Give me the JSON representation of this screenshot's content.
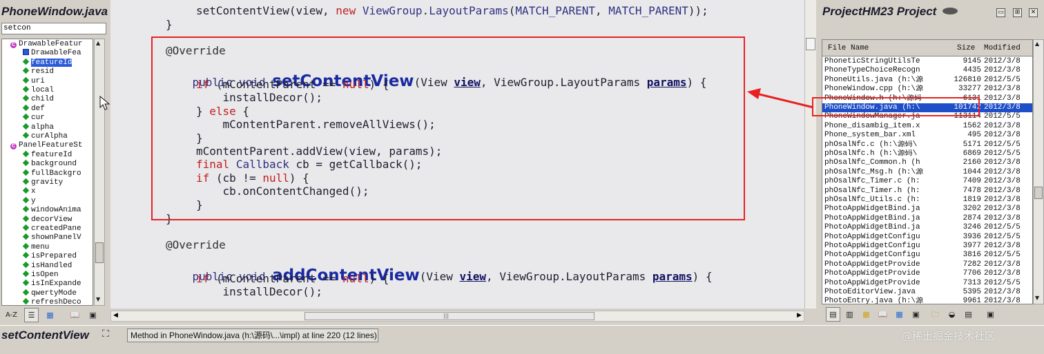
{
  "left_panel": {
    "title": "PhoneWindow.java",
    "search_value": "setcon",
    "tree": [
      {
        "label": "DrawableFeatur",
        "kind": "class",
        "depth": 0
      },
      {
        "label": "DrawableFea",
        "kind": "selected-class",
        "depth": 1
      },
      {
        "label": "featureId",
        "kind": "field",
        "depth": 1,
        "selected": true
      },
      {
        "label": "resid",
        "kind": "field",
        "depth": 1
      },
      {
        "label": "uri",
        "kind": "field",
        "depth": 1
      },
      {
        "label": "local",
        "kind": "field",
        "depth": 1
      },
      {
        "label": "child",
        "kind": "field",
        "depth": 1
      },
      {
        "label": "def",
        "kind": "field",
        "depth": 1
      },
      {
        "label": "cur",
        "kind": "field",
        "depth": 1
      },
      {
        "label": "alpha",
        "kind": "field",
        "depth": 1
      },
      {
        "label": "curAlpha",
        "kind": "field",
        "depth": 1
      },
      {
        "label": "PanelFeatureSt",
        "kind": "class",
        "depth": 0
      },
      {
        "label": "featureId",
        "kind": "field",
        "depth": 1
      },
      {
        "label": "background",
        "kind": "field",
        "depth": 1
      },
      {
        "label": "fullBackgro",
        "kind": "field",
        "depth": 1
      },
      {
        "label": "gravity",
        "kind": "field",
        "depth": 1
      },
      {
        "label": "x",
        "kind": "field",
        "depth": 1
      },
      {
        "label": "y",
        "kind": "field",
        "depth": 1
      },
      {
        "label": "windowAnima",
        "kind": "field",
        "depth": 1
      },
      {
        "label": "decorView",
        "kind": "field",
        "depth": 1
      },
      {
        "label": "createdPane",
        "kind": "field",
        "depth": 1
      },
      {
        "label": "shownPanelV",
        "kind": "field",
        "depth": 1
      },
      {
        "label": "menu",
        "kind": "field",
        "depth": 1
      },
      {
        "label": "isPrepared",
        "kind": "field",
        "depth": 1
      },
      {
        "label": "isHandled",
        "kind": "field",
        "depth": 1
      },
      {
        "label": "isOpen",
        "kind": "field",
        "depth": 1
      },
      {
        "label": "isInExpande",
        "kind": "field",
        "depth": 1
      },
      {
        "label": "qwertyMode",
        "kind": "field",
        "depth": 1
      },
      {
        "label": "refreshDeco",
        "kind": "field",
        "depth": 1
      }
    ],
    "toolbar": [
      "A-Z",
      "list-view",
      "grid-view",
      "book",
      "properties"
    ]
  },
  "editor": {
    "top_line": "setContentView(view, new ViewGroup.LayoutParams(MATCH_PARENT, MATCH_PARENT));",
    "close_brace": "}",
    "method1": {
      "annotation": "@Override",
      "sig_prefix": "public void ",
      "name": "setContentView",
      "sig_args_a": "(View ",
      "arg1": "view",
      "sig_args_b": ", ViewGroup.LayoutParams ",
      "arg2": "params",
      "sig_end": ") {"
    },
    "body1": [
      "if (mContentParent == null) {",
      "    installDecor();",
      "} else {",
      "    mContentParent.removeAllViews();",
      "}",
      "mContentParent.addView(view, params);",
      "final Callback cb = getCallback();",
      "if (cb != null) {",
      "    cb.onContentChanged();",
      "}"
    ],
    "method1_close": "}",
    "method2": {
      "annotation": "@Override",
      "sig_prefix": "public void ",
      "name": "addContentView",
      "sig_args_a": "(View ",
      "arg1": "view",
      "sig_args_b": ", ViewGroup.LayoutParams ",
      "arg2": "params",
      "sig_end": ") {"
    },
    "body2": [
      "if (mContentParent == null) {",
      "    installDecor();"
    ]
  },
  "right_panel": {
    "title": "ProjectHM23 Project",
    "columns": {
      "name": "File Name",
      "size": "Size",
      "modified": "Modified"
    },
    "files": [
      {
        "name": "PhoneticStringUtilsTe",
        "size": "9145",
        "date": "2012/3/8"
      },
      {
        "name": "PhoneTypeChoiceRecogn",
        "size": "4435",
        "date": "2012/3/8"
      },
      {
        "name": "PhoneUtils.java (h:\\源",
        "size": "126810",
        "date": "2012/5/5"
      },
      {
        "name": "PhoneWindow.cpp (h:\\源",
        "size": "33277",
        "date": "2012/3/8"
      },
      {
        "name": "PhoneWindow.h (h:\\源码",
        "size": "6131",
        "date": "2012/3/8"
      },
      {
        "name": "PhoneWindow.java (h:\\",
        "size": "101742",
        "date": "2012/3/8",
        "selected": true
      },
      {
        "name": "PhoneWindowManager.ja",
        "size": "113114",
        "date": "2012/5/5"
      },
      {
        "name": "Phone_disambig_item.x",
        "size": "1562",
        "date": "2012/3/8"
      },
      {
        "name": "Phone_system_bar.xml",
        "size": "495",
        "date": "2012/3/8"
      },
      {
        "name": "phOsalNfc.c (h:\\源码\\",
        "size": "5171",
        "date": "2012/5/5"
      },
      {
        "name": "phOsalNfc.h (h:\\源码\\",
        "size": "6869",
        "date": "2012/5/5"
      },
      {
        "name": "phOsalNfc_Common.h (h",
        "size": "2160",
        "date": "2012/3/8"
      },
      {
        "name": "phOsalNfc_Msg.h (h:\\源",
        "size": "1044",
        "date": "2012/3/8"
      },
      {
        "name": "phOsalNfc_Timer.c (h:",
        "size": "7409",
        "date": "2012/3/8"
      },
      {
        "name": "phOsalNfc_Timer.h (h:",
        "size": "7478",
        "date": "2012/3/8"
      },
      {
        "name": "phOsalNfc_Utils.c (h:",
        "size": "1819",
        "date": "2012/3/8"
      },
      {
        "name": "PhotoAppWidgetBind.ja",
        "size": "3202",
        "date": "2012/3/8"
      },
      {
        "name": "PhotoAppWidgetBind.ja",
        "size": "2874",
        "date": "2012/3/8"
      },
      {
        "name": "PhotoAppWidgetBind.ja",
        "size": "3246",
        "date": "2012/5/5"
      },
      {
        "name": "PhotoAppWidgetConfigu",
        "size": "3936",
        "date": "2012/5/5"
      },
      {
        "name": "PhotoAppWidgetConfigu",
        "size": "3977",
        "date": "2012/3/8"
      },
      {
        "name": "PhotoAppWidgetConfigu",
        "size": "3816",
        "date": "2012/5/5"
      },
      {
        "name": "PhotoAppWidgetProvide",
        "size": "7282",
        "date": "2012/3/8"
      },
      {
        "name": "PhotoAppWidgetProvide",
        "size": "7706",
        "date": "2012/3/8"
      },
      {
        "name": "PhotoAppWidgetProvide",
        "size": "7313",
        "date": "2012/5/5"
      },
      {
        "name": "PhotoEditorView.java",
        "size": "5395",
        "date": "2012/3/8"
      },
      {
        "name": "PhotoEntry.java (h:\\源",
        "size": "9961",
        "date": "2012/3/8"
      }
    ]
  },
  "bottom_bar": {
    "symbol": "setContentView",
    "info": "Method in PhoneWindow.java (h:\\源码\\...\\impl) at line 220 (12 lines)",
    "watermark": "@稀土掘金技术社区"
  },
  "colors": {
    "highlight_red": "#e82020",
    "selection_blue": "#1e4ec8",
    "keyword": "#c02020",
    "method_name": "#1a2aa0"
  }
}
